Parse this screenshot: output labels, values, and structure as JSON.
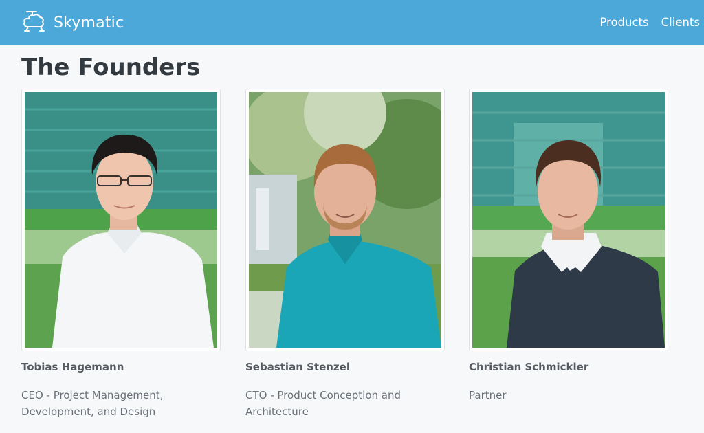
{
  "header": {
    "brand": "Skymatic",
    "nav": [
      "Products",
      "Clients"
    ]
  },
  "page": {
    "title": "The Founders"
  },
  "founders": [
    {
      "name": "Tobias Hagemann",
      "role": "CEO - Project Management, Development, and Design"
    },
    {
      "name": "Sebastian Stenzel",
      "role": "CTO - Product Conception and Architecture"
    },
    {
      "name": "Christian Schmickler",
      "role": "Partner"
    }
  ],
  "colors": {
    "navbar": "#4ba8d8",
    "background": "#f7f8fa"
  }
}
